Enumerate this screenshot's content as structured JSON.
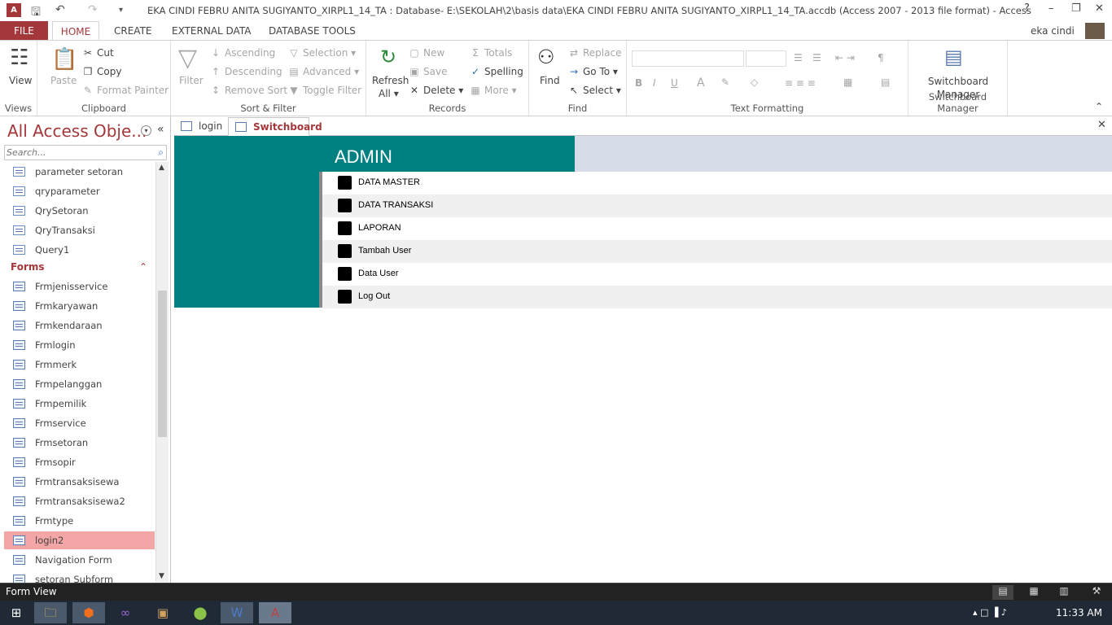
{
  "titlebar": {
    "title": "EKA CINDI FEBRU ANITA SUGIYANTO_XIRPL1_14_TA : Database- E:\\SEKOLAH\\2\\basis data\\EKA CINDI FEBRU ANITA SUGIYANTO_XIRPL1_14_TA.accdb (Access 2007 - 2013 file format) - Access",
    "help": "?"
  },
  "tabs": {
    "file": "FILE",
    "home": "HOME",
    "create": "CREATE",
    "external": "EXTERNAL DATA",
    "dbtools": "DATABASE TOOLS",
    "user": "eka cindi"
  },
  "ribbon": {
    "views": {
      "label": "Views",
      "view": "View"
    },
    "clipboard": {
      "label": "Clipboard",
      "paste": "Paste",
      "cut": "Cut",
      "copy": "Copy",
      "format_painter": "Format Painter"
    },
    "sortfilter": {
      "label": "Sort & Filter",
      "filter": "Filter",
      "ascending": "Ascending",
      "descending": "Descending",
      "remove_sort": "Remove Sort",
      "selection": "Selection",
      "advanced": "Advanced",
      "toggle_filter": "Toggle Filter"
    },
    "records": {
      "label": "Records",
      "refresh": "Refresh",
      "all": "All",
      "new": "New",
      "save": "Save",
      "delete": "Delete",
      "totals": "Totals",
      "spelling": "Spelling",
      "more": "More"
    },
    "find": {
      "label": "Find",
      "find": "Find",
      "replace": "Replace",
      "goto": "Go To",
      "select": "Select"
    },
    "textformatting": {
      "label": "Text Formatting"
    },
    "switchboard": {
      "label": "Switchboard Manager",
      "button": "Switchboard Manager"
    }
  },
  "nav": {
    "title": "All Access Obje...",
    "search_placeholder": "Search...",
    "queries": [
      "parameter setoran",
      "qryparameter",
      "QrySetoran",
      "QryTransaksi",
      "Query1"
    ],
    "forms_group": "Forms",
    "forms": [
      "Frmjenisservice",
      "Frmkaryawan",
      "Frmkendaraan",
      "Frmlogin",
      "Frmmerk",
      "Frmpelanggan",
      "Frmpemilik",
      "Frmservice",
      "Frmsetoran",
      "Frmsopir",
      "Frmtransaksisewa",
      "Frmtransaksisewa2",
      "Frmtype",
      "login2",
      "Navigation Form",
      "setoran Subform"
    ],
    "selected": "login2"
  },
  "doctabs": [
    {
      "label": "login"
    },
    {
      "label": "Switchboard"
    }
  ],
  "switchboard": {
    "heading": "ADMIN",
    "items": [
      "DATA MASTER",
      "DATA TRANSAKSI",
      "LAPORAN",
      "Tambah User",
      "Data User",
      "Log Out"
    ]
  },
  "status": {
    "text": "Form View"
  },
  "taskbar": {
    "time": "11:33 AM"
  },
  "colors": {
    "accent": "#a4373a",
    "teal": "#008080",
    "selected": "#f4a6a6"
  }
}
